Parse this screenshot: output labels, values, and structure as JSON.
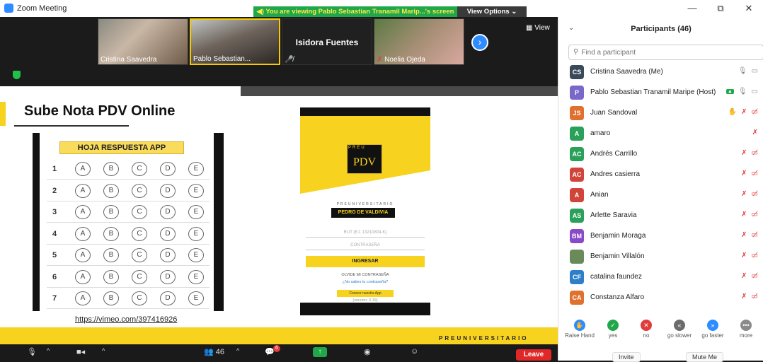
{
  "window": {
    "title": "Zoom Meeting",
    "minimize": "—",
    "restore": "⧉",
    "close": "✕"
  },
  "share_banner": {
    "text": "You are viewing Pablo Sebastian Tranamil Marip...'s screen",
    "view_options": "View Options ⌄"
  },
  "video_strip": {
    "view_label": "View",
    "tiles": [
      {
        "name": "Cristina Saavedra"
      },
      {
        "name": "Pablo Sebastian..."
      },
      {
        "name": "Isidora Fuentes"
      },
      {
        "name": "Noelia Ojeda"
      }
    ]
  },
  "slide": {
    "title": "Sube Nota PDV Online",
    "sheet_header": "HOJA RESPUESTA APP",
    "rows": [
      "1",
      "2",
      "3",
      "4",
      "5",
      "6",
      "7"
    ],
    "options": [
      "A",
      "B",
      "C",
      "D",
      "E"
    ],
    "link": "https://vimeo.com/397416926",
    "phone": {
      "logo_small": "PREU",
      "logo_big": "PDV",
      "brand_small": "PREUNIVERSITARIO",
      "brand": "PEDRO DE VALDIVIA",
      "rut_placeholder": "RUT (EJ. 13210804-K)",
      "password_placeholder": "CONTRASEÑA",
      "login_button": "INGRESAR",
      "forgot": "OLVIDE MI CONTRASEÑA",
      "no_password": "¿No sabes tu contraseña?",
      "know_app": "Conoce nuestra App",
      "version": "(version: 3.19)"
    },
    "footer_brand": "PREUNIVERSITARIO"
  },
  "toolbar": {
    "participants_count": "46",
    "chat_badge": "6",
    "leave": "Leave"
  },
  "participants": {
    "title": "Participants (46)",
    "search_placeholder": "Find a participant",
    "list": [
      {
        "initials": "CS",
        "name": "Cristina Saavedra (Me)",
        "color": "#3b4a5a"
      },
      {
        "initials": "P",
        "name": "Pablo Sebastian Tranamil Maripe (Host)",
        "color": "#7a68c8"
      },
      {
        "initials": "JS",
        "name": "Juan Sandoval",
        "color": "#e0702e"
      },
      {
        "initials": "A",
        "name": "amaro",
        "color": "#2aa15a"
      },
      {
        "initials": "AC",
        "name": "Andrés Carrillo",
        "color": "#2aa15a"
      },
      {
        "initials": "AC",
        "name": "Andres casierra",
        "color": "#d0443a"
      },
      {
        "initials": "A",
        "name": "Anian",
        "color": "#d0443a"
      },
      {
        "initials": "AS",
        "name": "Arlette Saravia",
        "color": "#2aa15a"
      },
      {
        "initials": "BM",
        "name": "Benjamin Moraga",
        "color": "#8a4ac8"
      },
      {
        "initials": "",
        "name": "Benjamin Villalón",
        "color": "#6a8a5a"
      },
      {
        "initials": "CF",
        "name": "catalina faundez",
        "color": "#2d7fc8"
      },
      {
        "initials": "CA",
        "name": "Constanza Alfaro",
        "color": "#e0702e"
      }
    ],
    "reactions": [
      {
        "label": "Raise Hand",
        "color": "#2d8cff",
        "glyph": "✋"
      },
      {
        "label": "yes",
        "color": "#1fa74a",
        "glyph": "✓"
      },
      {
        "label": "no",
        "color": "#e03c3c",
        "glyph": "✕"
      },
      {
        "label": "go slower",
        "color": "#6b6b6b",
        "glyph": "«"
      },
      {
        "label": "go faster",
        "color": "#2d8cff",
        "glyph": "»"
      },
      {
        "label": "more",
        "color": "#8a8a8a",
        "glyph": "•••"
      }
    ],
    "invite": "Invite",
    "mute_me": "Mute Me"
  }
}
